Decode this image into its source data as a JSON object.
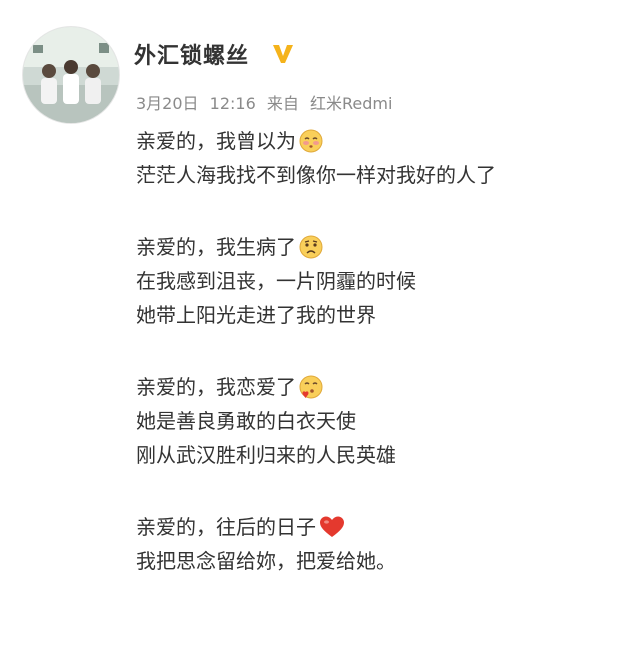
{
  "user": {
    "name": "外汇锁螺丝",
    "verified_icon": "verified-v-badge-icon",
    "avatar_icon": "group-photo-avatar"
  },
  "meta": {
    "date": "3月20日",
    "time": "12:16",
    "source_prefix": "来自",
    "source": "红米Redmi"
  },
  "post": {
    "lines": [
      {
        "text": "亲爱的，我曾以为",
        "emoji": "blushing-face-icon"
      },
      {
        "text": "茫茫人海我找不到像你一样对我好的人了"
      },
      {
        "text": "亲爱的，我生病了",
        "emoji": "sad-face-icon"
      },
      {
        "text": "在我感到沮丧，一片阴霾的时候"
      },
      {
        "text": "她带上阳光走进了我的世界"
      },
      {
        "text": "亲爱的，我恋爱了",
        "emoji": "kissing-face-icon"
      },
      {
        "text": "她是善良勇敢的白衣天使"
      },
      {
        "text": "刚从武汉胜利归来的人民英雄"
      },
      {
        "text": "亲爱的，往后的日子",
        "emoji": "red-heart-icon"
      },
      {
        "text": "我把思念留给妳，把爱给她。"
      }
    ]
  },
  "colors": {
    "text": "#333333",
    "meta": "#8a8a8a",
    "verify_badge": "#f5b31b",
    "heart": "#e4392e",
    "emoji_face": "#f9cf5a"
  }
}
